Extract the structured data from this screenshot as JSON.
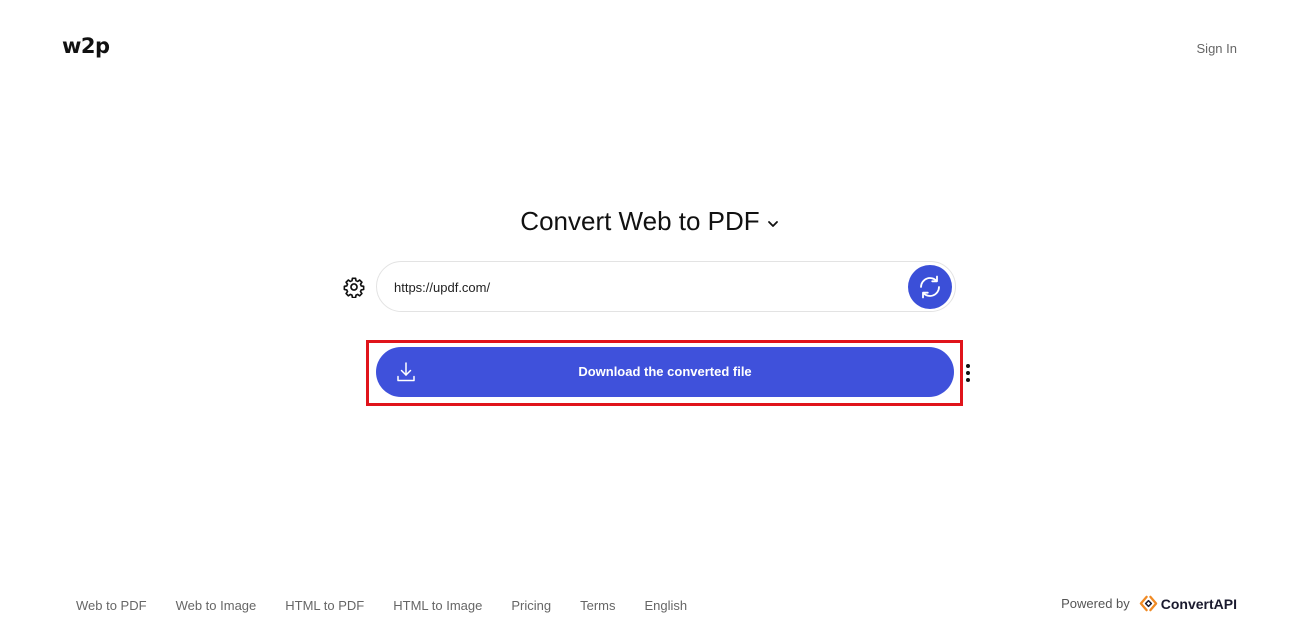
{
  "header": {
    "logo": "w2p",
    "sign_in": "Sign In"
  },
  "main": {
    "title": "Convert Web to PDF",
    "url_value": "https://updf.com/",
    "download_label": "Download the converted file"
  },
  "footer": {
    "links": [
      "Web to PDF",
      "Web to Image",
      "HTML to PDF",
      "HTML to Image",
      "Pricing",
      "Terms",
      "English"
    ],
    "powered_by": "Powered by",
    "brand": "ConvertAPI"
  },
  "colors": {
    "accent": "#3f51db",
    "highlight": "#e0141b",
    "brand_orange": "#f08a24"
  },
  "icons": {
    "settings": "gear-icon",
    "refresh": "refresh-icon",
    "download": "download-icon",
    "title_dropdown": "chevron-down-icon",
    "more": "more-vertical-icon",
    "brand": "convertapi-logo"
  }
}
